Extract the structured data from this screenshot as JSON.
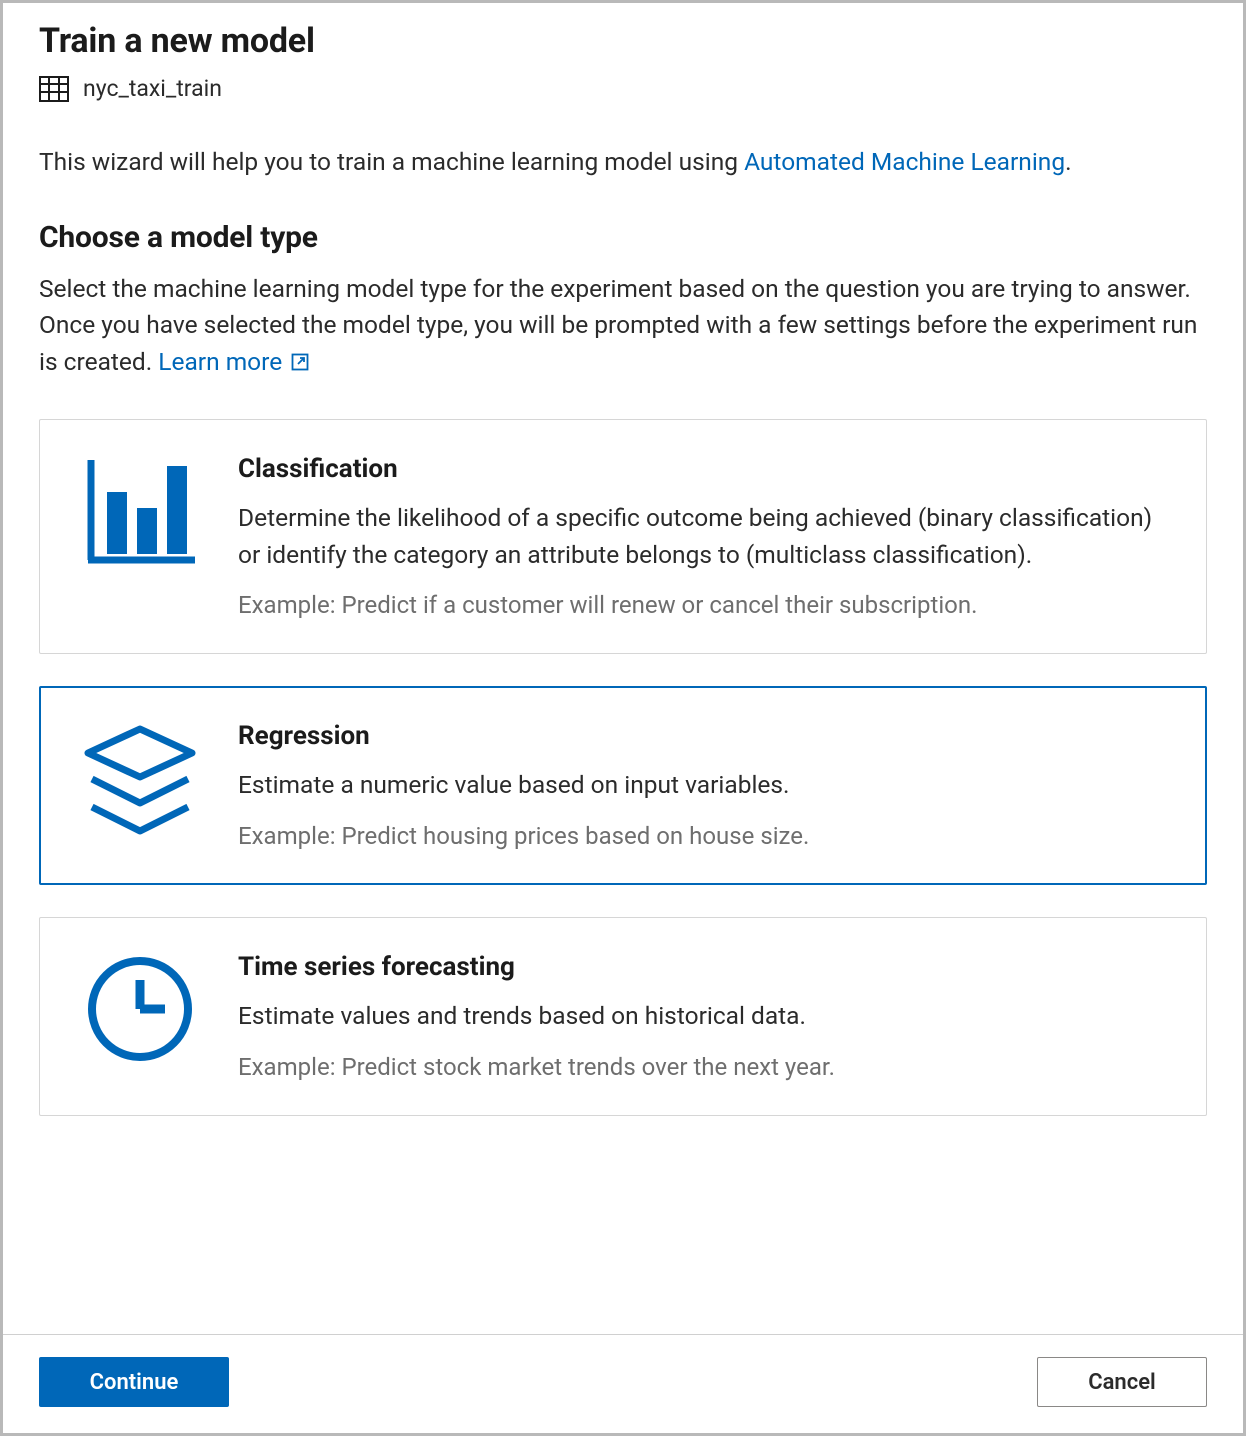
{
  "header": {
    "title": "Train a new model",
    "dataset_name": "nyc_taxi_train"
  },
  "wizard": {
    "desc_prefix": "This wizard will help you to train a machine learning model using ",
    "desc_link": "Automated Machine Learning",
    "desc_suffix": "."
  },
  "section": {
    "title": "Choose a model type",
    "desc": "Select the machine learning model type for the experiment based on the question you are trying to answer. Once you have selected the model type, you will be prompted with a few settings before the experiment run is created. ",
    "learn_more": "Learn more"
  },
  "cards": [
    {
      "id": "classification",
      "title": "Classification",
      "desc": "Determine the likelihood of a specific outcome being achieved (binary classification) or identify the category an attribute belongs to (multiclass classification).",
      "example": "Example: Predict if a customer will renew or cancel their subscription.",
      "selected": false
    },
    {
      "id": "regression",
      "title": "Regression",
      "desc": "Estimate a numeric value based on input variables.",
      "example": "Example: Predict housing prices based on house size.",
      "selected": true
    },
    {
      "id": "forecasting",
      "title": "Time series forecasting",
      "desc": "Estimate values and trends based on historical data.",
      "example": "Example: Predict stock market trends over the next year.",
      "selected": false
    }
  ],
  "footer": {
    "continue_label": "Continue",
    "cancel_label": "Cancel"
  },
  "colors": {
    "accent": "#0067b8",
    "text": "#2b2b2b",
    "muted": "#6e6e6e"
  }
}
